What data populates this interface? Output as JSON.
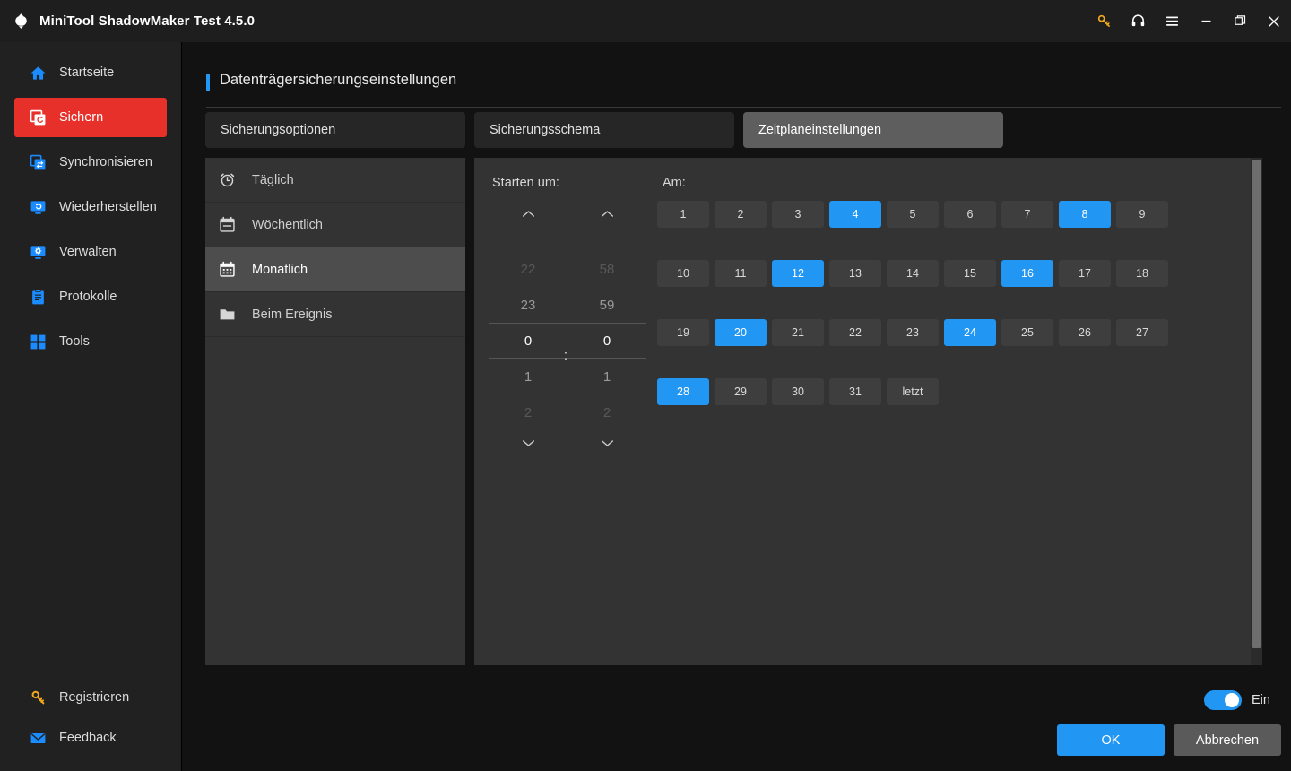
{
  "titlebar": {
    "app_name": "MiniTool ShadowMaker Test 4.5.0",
    "logo_icon": "shadowmaker-logo-icon",
    "buttons": [
      {
        "name": "key-icon",
        "label": "",
        "color": "#f0a81e"
      },
      {
        "name": "headset-icon",
        "label": "",
        "color": "#ffffff"
      },
      {
        "name": "menu-icon",
        "label": "",
        "color": "#ffffff"
      },
      {
        "name": "minimize-icon",
        "label": "",
        "color": "#ffffff"
      },
      {
        "name": "maximize-icon",
        "label": "",
        "color": "#ffffff"
      },
      {
        "name": "close-icon",
        "label": "",
        "color": "#ffffff"
      }
    ]
  },
  "sidebar": {
    "items": [
      {
        "label": "Startseite",
        "icon": "home-icon",
        "active": false
      },
      {
        "label": "Sichern",
        "icon": "backup-icon",
        "active": true
      },
      {
        "label": "Synchronisieren",
        "icon": "sync-icon",
        "active": false
      },
      {
        "label": "Wiederherstellen",
        "icon": "restore-icon",
        "active": false
      },
      {
        "label": "Verwalten",
        "icon": "manage-icon",
        "active": false
      },
      {
        "label": "Protokolle",
        "icon": "logs-icon",
        "active": false
      },
      {
        "label": "Tools",
        "icon": "tools-icon",
        "active": false
      }
    ],
    "bottom_items": [
      {
        "label": "Registrieren",
        "icon": "key-icon"
      },
      {
        "label": "Feedback",
        "icon": "mail-icon"
      }
    ],
    "active_color": "#e8302a",
    "icon_color": "#1a8cff"
  },
  "main": {
    "page_title": "Datenträgersicherungseinstellungen",
    "accent_color": "#2196f3",
    "tabs": [
      {
        "label": "Sicherungsoptionen",
        "active": false
      },
      {
        "label": "Sicherungsschema",
        "active": false
      },
      {
        "label": "Zeitplaneinstellungen",
        "active": true
      }
    ],
    "frequencies": [
      {
        "label": "Täglich",
        "icon": "alarm-clock-icon",
        "active": false
      },
      {
        "label": "Wöchentlich",
        "icon": "calendar-icon",
        "active": false
      },
      {
        "label": "Monatlich",
        "icon": "calendar-grid-icon",
        "active": true
      },
      {
        "label": "Beim Ereignis",
        "icon": "folder-icon",
        "active": false
      }
    ],
    "time_picker": {
      "label": "Starten um:",
      "separator": ":",
      "hours": {
        "values": [
          "22",
          "23",
          "0",
          "1",
          "2"
        ],
        "selected_index": 2,
        "selected_value": "0"
      },
      "minutes": {
        "values": [
          "58",
          "59",
          "0",
          "1",
          "2"
        ],
        "selected_index": 2,
        "selected_value": "0"
      },
      "up_arrow_icon": "chevron-up-icon",
      "down_arrow_icon": "chevron-down-icon"
    },
    "day_picker": {
      "label": "Am:",
      "selected_color": "#2196f3",
      "rows": [
        [
          {
            "label": "1",
            "selected": false
          },
          {
            "label": "2",
            "selected": false
          },
          {
            "label": "3",
            "selected": false
          },
          {
            "label": "4",
            "selected": true
          },
          {
            "label": "5",
            "selected": false
          },
          {
            "label": "6",
            "selected": false
          },
          {
            "label": "7",
            "selected": false
          },
          {
            "label": "8",
            "selected": true
          },
          {
            "label": "9",
            "selected": false
          }
        ],
        [
          {
            "label": "10",
            "selected": false
          },
          {
            "label": "11",
            "selected": false
          },
          {
            "label": "12",
            "selected": true
          },
          {
            "label": "13",
            "selected": false
          },
          {
            "label": "14",
            "selected": false
          },
          {
            "label": "15",
            "selected": false
          },
          {
            "label": "16",
            "selected": true
          },
          {
            "label": "17",
            "selected": false
          },
          {
            "label": "18",
            "selected": false
          }
        ],
        [
          {
            "label": "19",
            "selected": false
          },
          {
            "label": "20",
            "selected": true
          },
          {
            "label": "21",
            "selected": false
          },
          {
            "label": "22",
            "selected": false
          },
          {
            "label": "23",
            "selected": false
          },
          {
            "label": "24",
            "selected": true
          },
          {
            "label": "25",
            "selected": false
          },
          {
            "label": "26",
            "selected": false
          },
          {
            "label": "27",
            "selected": false
          }
        ],
        [
          {
            "label": "28",
            "selected": true
          },
          {
            "label": "29",
            "selected": false
          },
          {
            "label": "30",
            "selected": false
          },
          {
            "label": "31",
            "selected": false
          },
          {
            "label": "letzt",
            "selected": false
          }
        ]
      ]
    }
  },
  "footer": {
    "toggle": {
      "label": "Ein",
      "on": true
    },
    "ok_label": "OK",
    "cancel_label": "Abbrechen"
  }
}
